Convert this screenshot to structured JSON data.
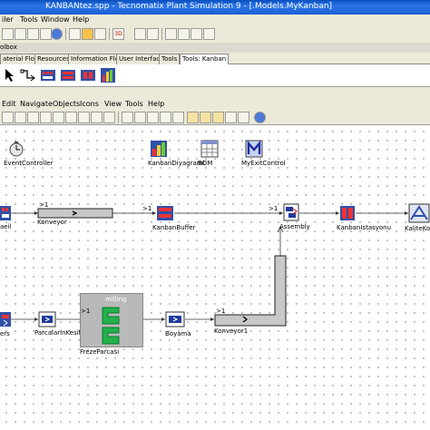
{
  "window": {
    "title": "KANBANtez.spp - Tecnomatix Plant Simulation 9 - [.Models.MyKanban]"
  },
  "menubar": {
    "file": "iler",
    "tools": "Tools",
    "window": "Window",
    "help": "Help"
  },
  "toolbox": {
    "header": "olbox",
    "tabs": [
      "aterial Flow",
      "Resources",
      "Information Flow",
      "User Interface",
      "Tools",
      "Tools: Kanban"
    ],
    "active_tab": 5
  },
  "frame_menu": [
    "Edit",
    "Navigate",
    "Objects",
    "Icons",
    "View",
    "Tools",
    "Help"
  ],
  "objects": {
    "event_controller": "EventController",
    "kanban_diyagrami": "KanbanDiyagrami",
    "bom": "BOM",
    "my_exit_control": "MyExitControl",
    "source_top": "aeil",
    "konveyor": "Konveyor",
    "kanban_buffer": "KanbanBuffer",
    "assembly": "Assembly",
    "kanban_istasyonu": "KanbanIstasyonu",
    "kalite_kontrol": "KaliteKon",
    "source_bottom": "ers",
    "parca_kesilmesi": "ParcalarinKesilmesi",
    "milling": "milling",
    "freze_parcasi": "FrezeParcasi",
    "boyama": "Boyama",
    "konveyor1": "Konveyor1"
  },
  "port_labels": {
    "in": ">1"
  },
  "colors": {
    "titlebar": "#1b5fd6",
    "chrome": "#ece9d8",
    "accent": "#d12020",
    "milling_bg": "#b9b9b9"
  }
}
